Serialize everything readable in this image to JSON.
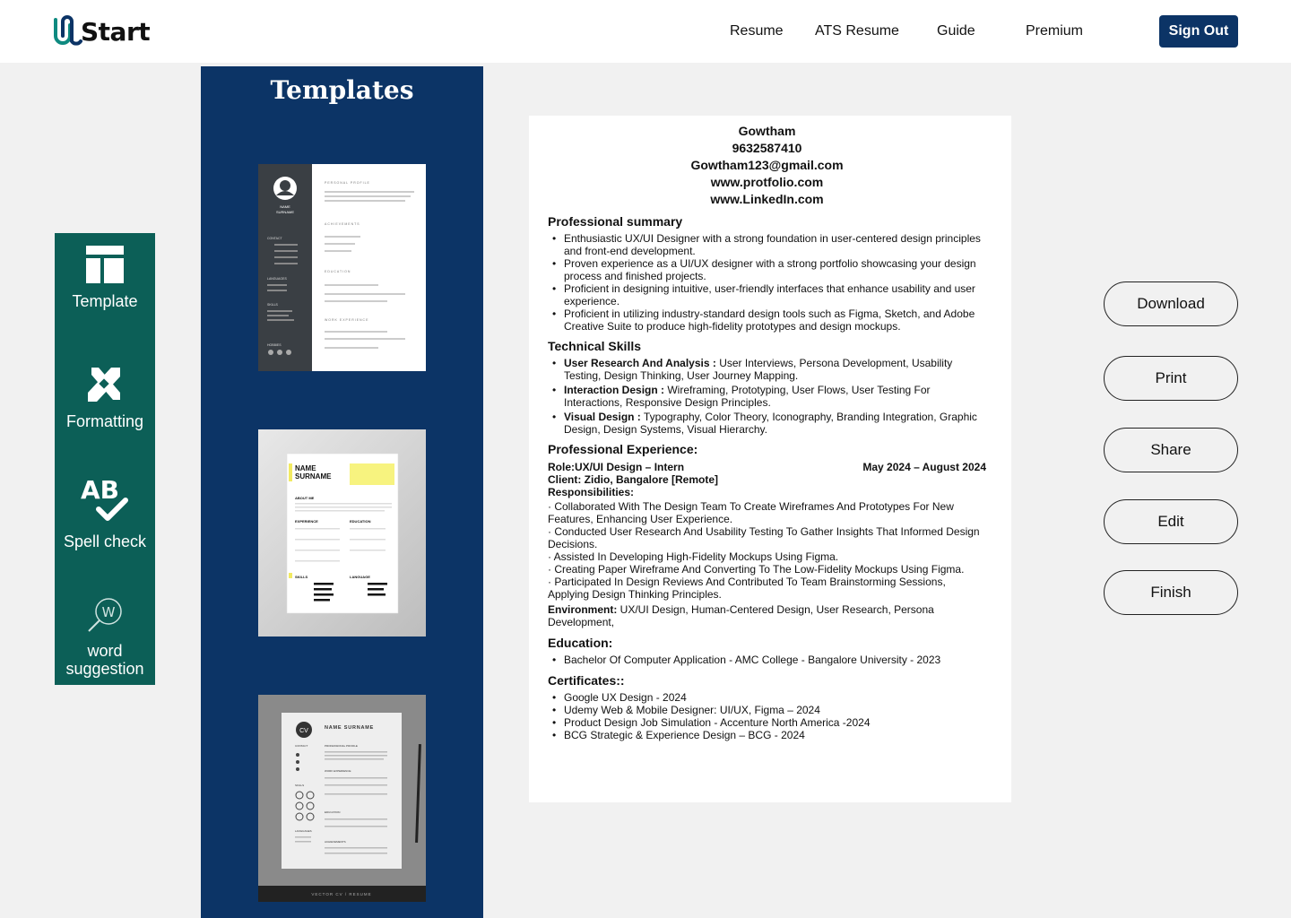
{
  "header": {
    "logo_text": "Start",
    "nav": [
      "Resume",
      "ATS Resume",
      "Guide",
      "Premium"
    ],
    "sign_out": "Sign Out"
  },
  "tools": {
    "template": "Template",
    "formatting": "Formatting",
    "spellcheck": "Spell check",
    "word_line1": "word",
    "word_line2": "suggestion",
    "word_icon_letter": "W",
    "spell_icon_letters": "AB"
  },
  "templates": {
    "title": "Templates",
    "t1": {
      "name": "NAME",
      "surname": "SURNAME",
      "sections": [
        "PERSONAL PROFILE",
        "ACHIEVEMENTS",
        "EDUCATION",
        "WORK EXPERIENCE"
      ],
      "side": [
        "CONTACT",
        "LANGUAGES",
        "SKILLS",
        "HOBBIES"
      ]
    },
    "t2": {
      "name": "NAME",
      "surname": "SURNAME",
      "about": "ABOUT ME",
      "experience": "EXPERIENCE",
      "education": "EDUCATION",
      "skills": "SKILLS",
      "language": "LANGUAGE"
    },
    "t3": {
      "cv": "CV",
      "name": "NAME SURNAME",
      "footer": "VECTOR CV / RESUME",
      "labels": [
        "CONTACT",
        "PROFESSIONAL PROFILE",
        "WORK EXPERIENCE",
        "SKILLS",
        "EDUCATION",
        "LANGUAGES",
        "ACHIEVEMENTS"
      ]
    }
  },
  "resume": {
    "name": "Gowtham",
    "phone": "9632587410",
    "email": "Gowtham123@gmail.com",
    "portfolio": "www.protfolio.com",
    "linkedin": "www.LinkedIn.com",
    "summary_title": "Professional summary",
    "summary": [
      "Enthusiastic UX/UI Designer with a strong foundation in user-centered design principles and front-end development.",
      "Proven experience as a UI/UX designer with a strong portfolio showcasing your design process and finished projects.",
      "Proficient in designing intuitive, user-friendly interfaces that enhance usability and user experience.",
      "Proficient in utilizing industry-standard design tools such as Figma, Sketch, and Adobe Creative Suite to produce high-fidelity prototypes and design mockups."
    ],
    "skills_title": "Technical Skills",
    "skills": [
      {
        "head": "User Research And Analysis :",
        "text": " User Interviews, Persona Development, Usability Testing, Design Thinking, User Journey Mapping."
      },
      {
        "head": "Interaction Design :",
        "text": " Wireframing, Prototyping, User Flows, User Testing For Interactions, Responsive Design Principles."
      },
      {
        "head": "Visual Design :",
        "text": " Typography, Color Theory, Iconography, Branding Integration, Graphic Design, Design Systems, Visual Hierarchy."
      }
    ],
    "exp_title": "Professional Experience:",
    "role": "Role:UX/UI Design – Intern",
    "dates": "May 2024 – August 2024",
    "client": "Client: Zidio, Bangalore [Remote]",
    "resp_title": "Responsibilities:",
    "responsibilities": [
      "· Collaborated With The Design Team To Create Wireframes And Prototypes For New Features, Enhancing User Experience.",
      "· Conducted User Research And Usability Testing To Gather Insights That Informed Design Decisions.",
      "·  Assisted In Developing High-Fidelity Mockups Using Figma.",
      "·  Creating Paper Wireframe And Converting To The Low-Fidelity Mockups Using Figma.",
      "·  Participated In Design Reviews And Contributed To Team Brainstorming Sessions, Applying Design Thinking Principles."
    ],
    "env_label": "Environment:",
    "env_text": " UX/UI Design, Human-Centered Design, User Research, Persona Development,",
    "edu_title": "Education:",
    "education": [
      "Bachelor Of Computer Application - AMC College - Bangalore University - 2023"
    ],
    "cert_title": "Certificates::",
    "certificates": [
      "Google UX Design  -   2024",
      "Udemy Web & Mobile Designer: UI/UX, Figma – 2024",
      "Product Design Job Simulation - Accenture North America -2024",
      "BCG Strategic & Experience Design – BCG - 2024"
    ]
  },
  "actions": [
    "Download",
    "Print",
    "Share",
    "Edit",
    "Finish"
  ],
  "colors": {
    "navy": "#0c3466",
    "teal": "#0c5f57",
    "logo_teal": "#0e8a80"
  }
}
